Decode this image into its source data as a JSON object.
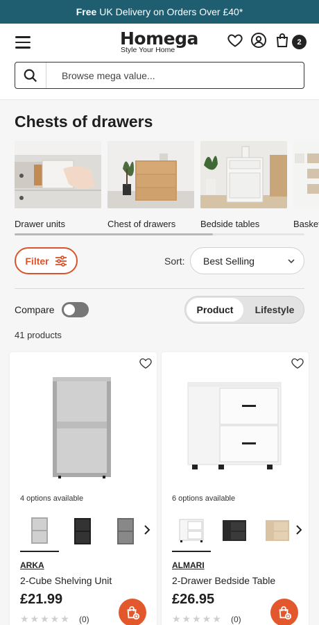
{
  "promo": {
    "bold": "Free",
    "text": "UK Delivery on Orders Over £40*"
  },
  "header": {
    "logo": "Homega",
    "tagline": "Style Your Home",
    "cart_count": "2",
    "search_placeholder": "Browse mega value..."
  },
  "page_title": "Chests of drawers",
  "categories": [
    {
      "label": "Drawer units"
    },
    {
      "label": "Chest of drawers"
    },
    {
      "label": "Bedside tables"
    },
    {
      "label": "Baskets"
    }
  ],
  "toolbar": {
    "filter_label": "Filter",
    "sort_label": "Sort:",
    "sort_value": "Best Selling",
    "compare_label": "Compare",
    "view_product": "Product",
    "view_lifestyle": "Lifestyle",
    "product_count": "41 products"
  },
  "products": [
    {
      "options": "4 options available",
      "brand": "ARKA",
      "name": "2-Cube Shelving Unit",
      "price": "£21.99",
      "reviews": "(0)"
    },
    {
      "options": "6 options available",
      "brand": "ALMARI",
      "name": "2-Drawer Bedside Table",
      "price": "£26.95",
      "reviews": "(0)"
    }
  ],
  "colors": {
    "promo_bg": "#1f5e70",
    "accent": "#d9542b",
    "cart_button": "#e2582c"
  },
  "icons": [
    "menu-icon",
    "heart-icon",
    "account-icon",
    "bag-icon",
    "search-icon",
    "filter-sliders-icon",
    "chevron-down-icon",
    "chevron-right-icon",
    "add-to-bag-icon"
  ]
}
